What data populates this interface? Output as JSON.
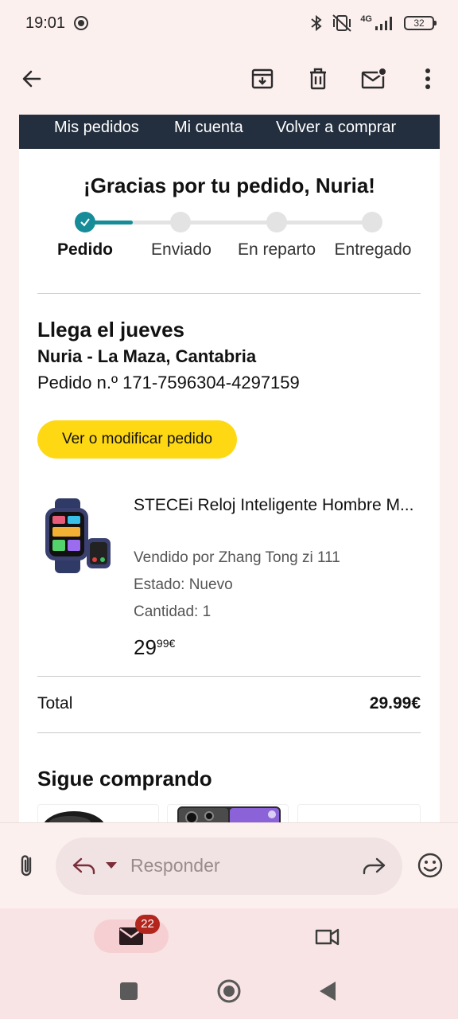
{
  "status_bar": {
    "time": "19:01",
    "network": "4G",
    "battery": "32"
  },
  "toolbar": {
    "back": "back-arrow",
    "archive": "archive",
    "delete": "delete",
    "mark_unread": "mark-unread",
    "more": "more-vertical"
  },
  "email": {
    "nav_links": [
      "Mis pedidos",
      "Mi cuenta",
      "Volver a comprar"
    ],
    "thanks_heading": "¡Gracias por tu pedido, Nuria!",
    "progress": {
      "steps": [
        "Pedido",
        "Enviado",
        "En reparto",
        "Entregado"
      ],
      "current_step": 1,
      "accent_color": "#178c99"
    },
    "arrival": "Llega el jueves",
    "recipient": "Nuria - La Maza, Cantabria",
    "order_number": "Pedido n.º 171-7596304-4297159",
    "modify_button": "Ver o modificar pedido",
    "product": {
      "title": "STECEi Reloj Inteligente Hombre M...",
      "seller": "Vendido por Zhang Tong zi 111",
      "condition": "Estado: Nuevo",
      "quantity": "Cantidad: 1",
      "price_whole": "29",
      "price_fraction": "99€"
    },
    "total_label": "Total",
    "total_value": "29.99€",
    "keep_shopping": "Sigue comprando"
  },
  "reply_bar": {
    "placeholder": "Responder"
  },
  "bottom_tabs": {
    "mail_badge": "22"
  },
  "colors": {
    "nav_background": "#232f3e",
    "button_yellow": "#ffd814",
    "badge_red": "#b3261e"
  }
}
